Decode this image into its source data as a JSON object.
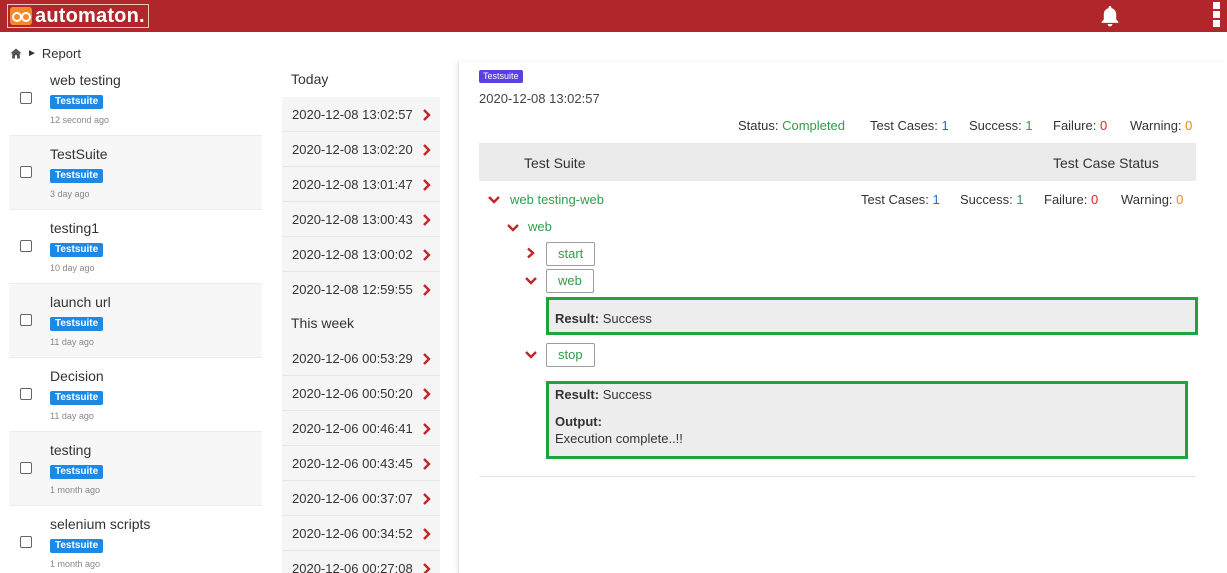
{
  "header": {
    "app_name": "automaton.",
    "brand_color": "#b0262a",
    "bell_icon": "bell-icon",
    "menu_icon": "kebab-menu-icon"
  },
  "breadcrumb": {
    "home_icon": "home-icon",
    "separator": "►",
    "current": "Report"
  },
  "suites": [
    {
      "name": "web testing",
      "badge": "Testsuite",
      "ago": "12 second ago"
    },
    {
      "name": "TestSuite",
      "badge": "Testsuite",
      "ago": "3 day ago"
    },
    {
      "name": "testing1",
      "badge": "Testsuite",
      "ago": "10 day ago"
    },
    {
      "name": "launch url",
      "badge": "Testsuite",
      "ago": "11 day ago"
    },
    {
      "name": "Decision",
      "badge": "Testsuite",
      "ago": "11 day ago"
    },
    {
      "name": "testing",
      "badge": "Testsuite",
      "ago": "1 month ago"
    },
    {
      "name": "selenium scripts",
      "badge": "Testsuite",
      "ago": "1 month ago"
    }
  ],
  "runs": {
    "today_label": "Today",
    "today": [
      "2020-12-08 13:02:57",
      "2020-12-08 13:02:20",
      "2020-12-08 13:01:47",
      "2020-12-08 13:00:43",
      "2020-12-08 13:00:02",
      "2020-12-08 12:59:55"
    ],
    "week_label": "This week",
    "week": [
      "2020-12-06 00:53:29",
      "2020-12-06 00:50:20",
      "2020-12-06 00:46:41",
      "2020-12-06 00:43:45",
      "2020-12-06 00:37:07",
      "2020-12-06 00:34:52",
      "2020-12-06 00:27:08"
    ]
  },
  "report": {
    "type_tag": "Testsuite",
    "date": "2020-12-08 13:02:57",
    "summary": {
      "status_label": "Status:",
      "status": "Completed",
      "cases_label": "Test Cases:",
      "cases": "1",
      "success_label": "Success:",
      "success": "1",
      "failure_label": "Failure:",
      "failure": "0",
      "warning_label": "Warning:",
      "warning": "0"
    },
    "table_headers": {
      "suite": "Test Suite",
      "status": "Test Case Status"
    },
    "suite_row": {
      "name": "web testing-web",
      "cases_label": "Test Cases:",
      "cases": "1",
      "success_label": "Success:",
      "success": "1",
      "failure_label": "Failure:",
      "failure": "0",
      "warning_label": "Warning:",
      "warning": "0"
    },
    "group": "web",
    "steps": {
      "start": "start",
      "web": "web",
      "stop": "stop"
    },
    "web_result": {
      "label": "Result:",
      "value": "Success"
    },
    "stop_result": {
      "label": "Result:",
      "value": "Success",
      "output_label": "Output:",
      "output": "Execution complete..!!"
    },
    "colors": {
      "success": "#2e9e4b",
      "count": "#1e6fc8",
      "failure": "#e02424",
      "warning": "#f08a00",
      "highlight": "#1fa33b",
      "tag": "#5b3ee8"
    }
  }
}
